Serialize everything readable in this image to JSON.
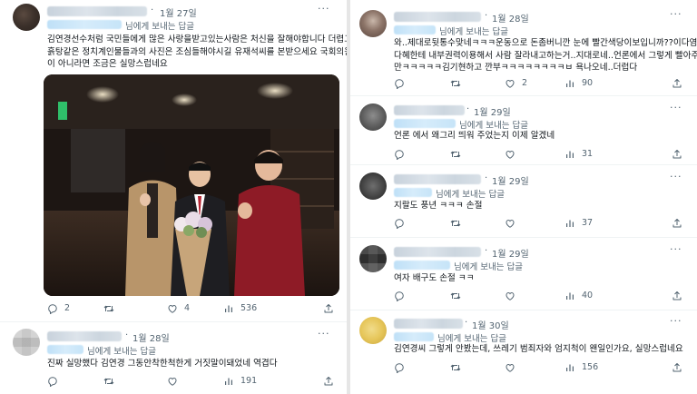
{
  "left_panel": {
    "tweets": [
      {
        "date": "1월 27일",
        "reply_label": "님에게 보내는 답글",
        "lines": [
          "김연경선수처럼 국민들에게 많은 사랑을받고있는사람은 처신을 잘해야합니다 더렵고 진",
          "흙탕같은 정치계인물들과의 사진은 조심들해야시길 유재석씨를 본받으세요 국회의원 욕심",
          "이 아니라면 조금은 실망스럽네요"
        ],
        "actions": {
          "reply": "2",
          "retweet": "",
          "like": "4",
          "views": "536"
        }
      },
      {
        "date": "1월 28일",
        "reply_label": "님에게 보내는 답글",
        "lines": [
          "진짜 실망했다 김연경 그동안착한척한게 거짓말이돼었네 역겹다"
        ],
        "actions": {
          "reply": "",
          "retweet": "",
          "like": "",
          "views": "191"
        }
      }
    ]
  },
  "right_panel": {
    "tweets": [
      {
        "date": "1월 28일",
        "reply_label": "님에게 보내는 답글",
        "lines": [
          "와..제대로뒷통수맞네ㅋㅋㅋ운동으로 돈좀버니깐 눈에 빨간색당이보입니까??이다염..이",
          "다혜한테 내부권력이용해서 사람 잘라내고하는거..지대로네..언론에서 그렇게 빨아주더",
          "만ㅋㅋㅋㅋㅋ김기현하고 깐부ㅋㅋㅋㅋㅋㅋㅋㅋㅂ 욕나오네..더럽다"
        ],
        "actions": {
          "reply": "",
          "retweet": "",
          "like": "2",
          "views": "90"
        }
      },
      {
        "date": "1월 29일",
        "reply_label": "님에게 보내는 답글",
        "lines": [
          "언론 에서 왜그리 띄워 주었는지 이제 알겠네"
        ],
        "actions": {
          "reply": "",
          "retweet": "",
          "like": "",
          "views": "31"
        }
      },
      {
        "date": "1월 29일",
        "reply_label": "님에게 보내는 답글",
        "lines": [
          "지랄도 풍년 ㅋㅋㅋ 손절"
        ],
        "actions": {
          "reply": "",
          "retweet": "",
          "like": "",
          "views": "37"
        }
      },
      {
        "date": "1월 29일",
        "reply_label": "님에게 보내는 답글",
        "lines": [
          "여자 배구도 손절 ㅋㅋ"
        ],
        "actions": {
          "reply": "",
          "retweet": "",
          "like": "",
          "views": "40"
        }
      },
      {
        "date": "1월 30일",
        "reply_label": "님에게 보내는 답글",
        "lines": [
          "김연경씨 그렇게 안봤는데, 쓰레기 범죄자와 엄지척이 왠일인가요, 실망스럽네요"
        ],
        "actions": {
          "reply": "",
          "retweet": "",
          "like": "",
          "views": "156"
        }
      }
    ]
  },
  "ui": {
    "dot": "·",
    "more": "···"
  }
}
